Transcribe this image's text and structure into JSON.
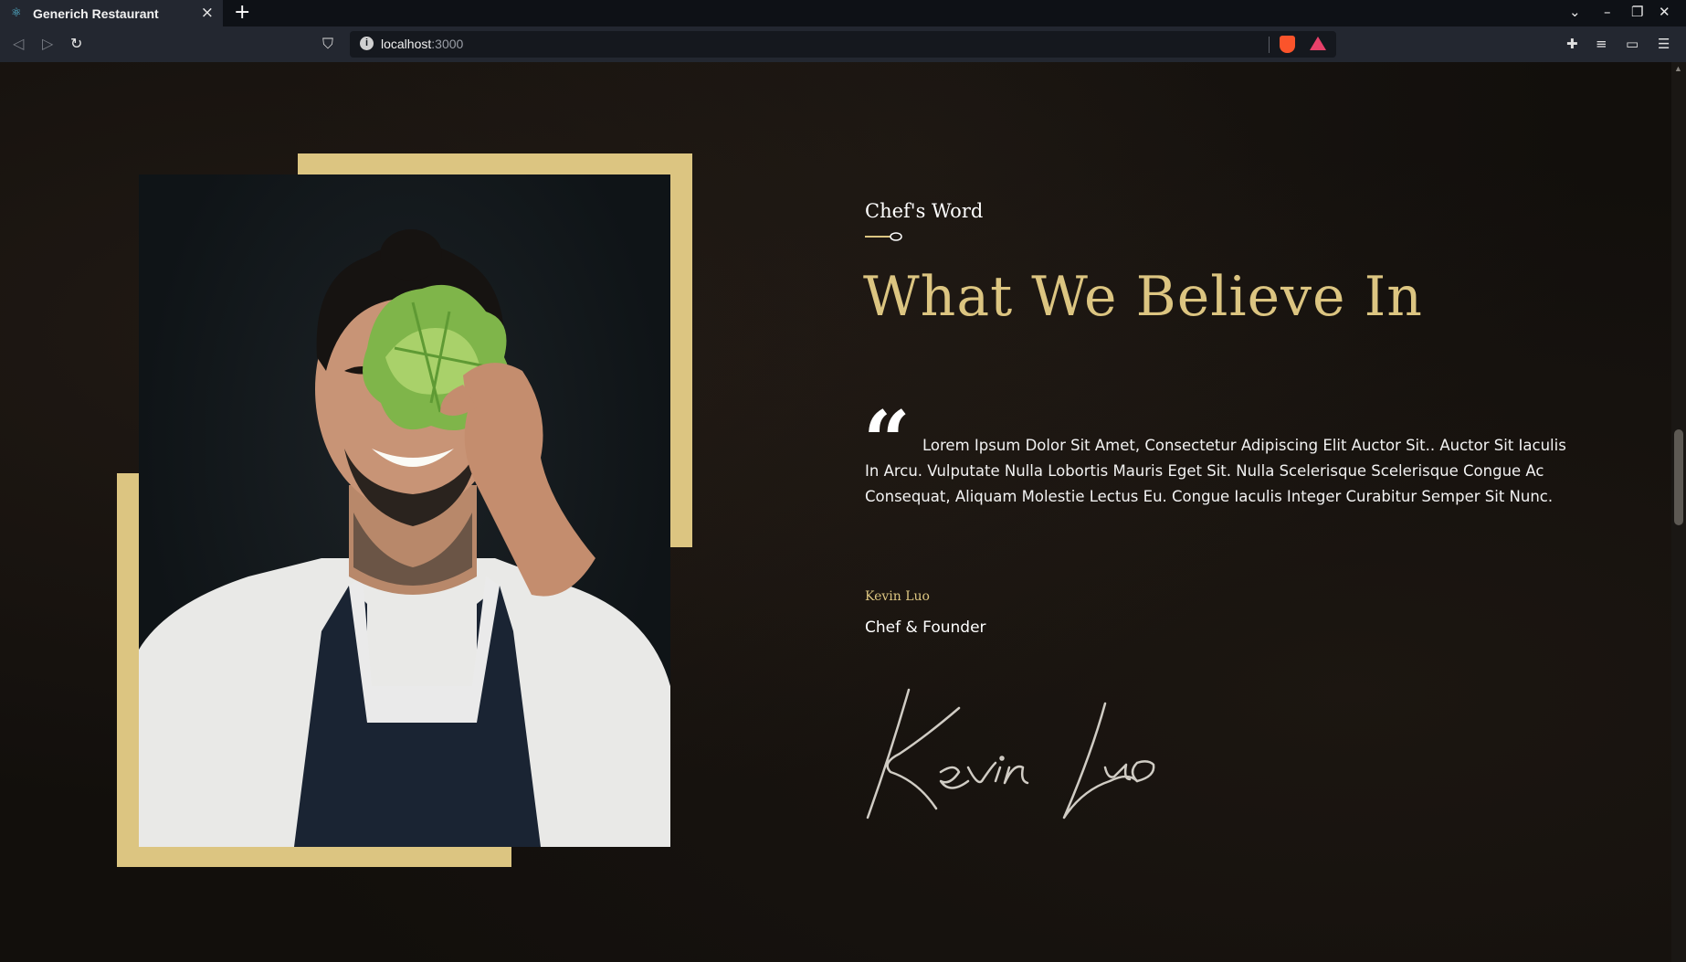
{
  "browser": {
    "tab_title": "Generich Restaurant",
    "url_host": "localhost",
    "url_port": ":3000"
  },
  "chef": {
    "eyebrow": "Chef's Word",
    "headline": "What We Believe In",
    "quote_mark": "“",
    "quote": "Lorem Ipsum Dolor Sit Amet, Consectetur Adipiscing Elit Auctor Sit.. Auctor Sit Iaculis In Arcu. Vulputate Nulla Lobortis Mauris Eget Sit. Nulla Scelerisque Scelerisque Congue Ac Consequat, Aliquam Molestie Lectus Eu. Congue Iaculis Integer Curabitur Semper Sit Nunc.",
    "author_name": "Kevin Luo",
    "author_role": "Chef & Founder",
    "signature": "Kevin Luo"
  },
  "colors": {
    "gold": "#dcc581",
    "background": "#120f0c"
  }
}
